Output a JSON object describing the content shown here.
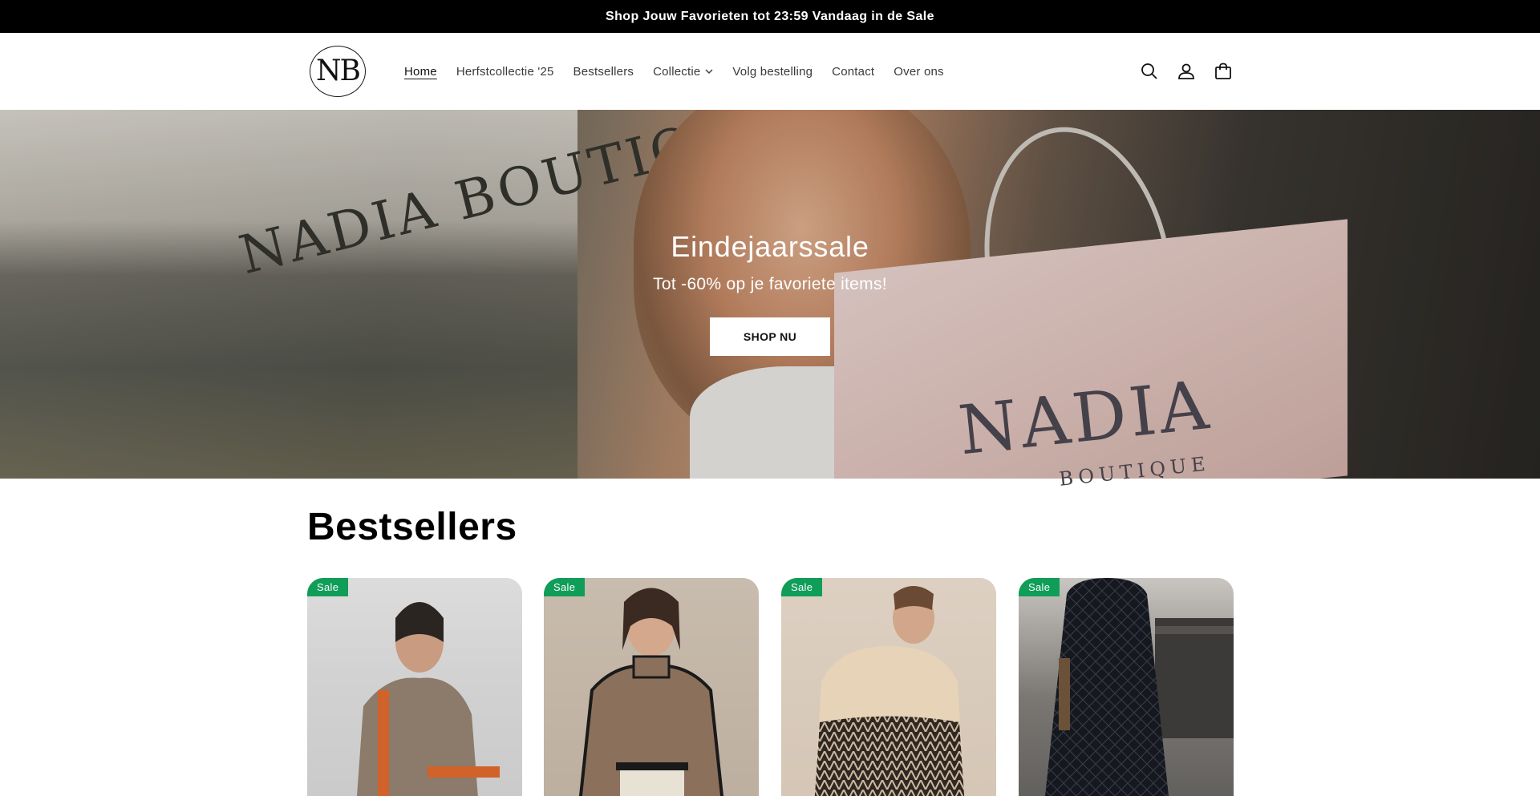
{
  "announcement": {
    "text": "Shop Jouw Favorieten tot 23:59 Vandaag in de Sale"
  },
  "header": {
    "logo_text": "NB",
    "nav": [
      {
        "label": "Home",
        "active": true
      },
      {
        "label": "Herfstcollectie '25",
        "active": false
      },
      {
        "label": "Bestsellers",
        "active": false
      },
      {
        "label": "Collectie",
        "active": false,
        "has_dropdown": true
      },
      {
        "label": "Volg bestelling",
        "active": false
      },
      {
        "label": "Contact",
        "active": false
      },
      {
        "label": "Over ons",
        "active": false
      }
    ],
    "icons": [
      "search-icon",
      "account-icon",
      "cart-icon"
    ]
  },
  "hero": {
    "title": "Eindejaarssale",
    "subtitle": "Tot -60% op je favoriete items!",
    "button_label": "SHOP NU",
    "image_sign_text": "NADIA BOUTIQUE",
    "image_bag_text": "NADIA",
    "image_bag_subtext": "BOUTIQUE"
  },
  "bestsellers": {
    "title": "Bestsellers",
    "products": [
      {
        "badge": "Sale"
      },
      {
        "badge": "Sale"
      },
      {
        "badge": "Sale"
      },
      {
        "badge": "Sale"
      }
    ]
  },
  "colors": {
    "announcement_bg": "#000000",
    "sale_badge": "#0f9d58",
    "text": "#121212"
  }
}
